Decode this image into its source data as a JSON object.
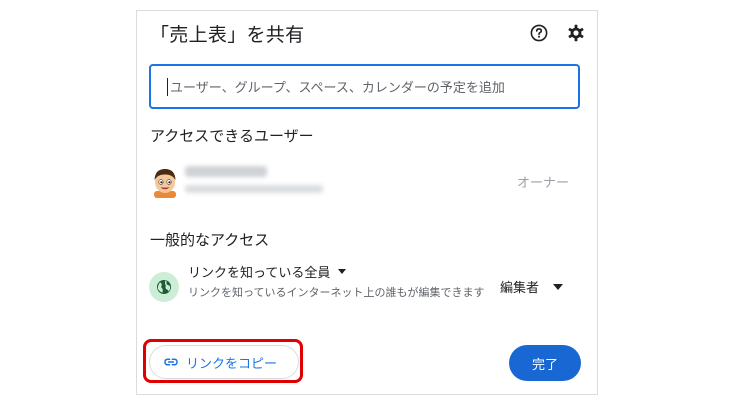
{
  "dialog": {
    "title": "「売上表」を共有",
    "help_icon": "help-circle-icon",
    "settings_icon": "gear-icon"
  },
  "search": {
    "placeholder": "ユーザー、グループ、スペース、カレンダーの予定を追加"
  },
  "people_section": {
    "heading": "アクセスできるユーザー",
    "users": [
      {
        "role": "オーナー",
        "avatar_icon": "cartoon-avatar"
      }
    ]
  },
  "general_access": {
    "heading": "一般的なアクセス",
    "icon": "globe-icon",
    "selected_option": "リンクを知っている全員",
    "description": "リンクを知っているインターネット上の誰もが編集できます",
    "role": "編集者"
  },
  "footer": {
    "copy_link_label": "リンクをコピー",
    "copy_link_icon": "link-icon",
    "done_label": "完了"
  },
  "colors": {
    "accent": "#1a73e8",
    "done_button": "#1967d2",
    "highlight": "#e00000",
    "globe_bg": "#cdeed6"
  }
}
